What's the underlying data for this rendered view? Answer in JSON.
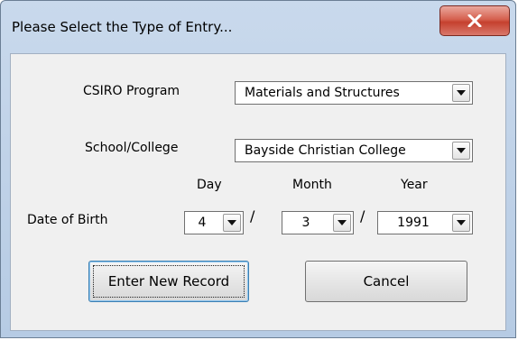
{
  "window": {
    "title": "Please Select the Type of Entry...",
    "close_icon": "close-x-icon"
  },
  "form": {
    "csiro_program": {
      "label": "CSIRO Program",
      "value": "Materials and Structures"
    },
    "school": {
      "label": "School/College",
      "value": "Bayside Christian College"
    },
    "dob": {
      "label": "Date of Birth",
      "day_header": "Day",
      "month_header": "Month",
      "year_header": "Year",
      "day": "4",
      "month": "3",
      "year": "1991",
      "separator": "/"
    }
  },
  "buttons": {
    "enter_label": "Enter New Record",
    "cancel_label": "Cancel"
  },
  "colors": {
    "close_button": "#c5402e",
    "frame": "#b6cbe4",
    "client": "#f0f0f0"
  },
  "icons": {
    "dropdown": "chevron-down-icon"
  }
}
